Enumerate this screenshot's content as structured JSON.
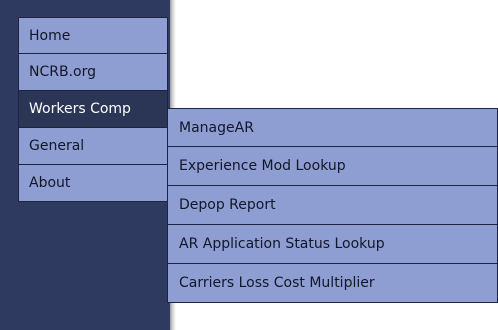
{
  "nav": {
    "items": [
      {
        "label": "Home"
      },
      {
        "label": "NCRB.org"
      },
      {
        "label": "Workers Comp"
      },
      {
        "label": "General"
      },
      {
        "label": "About"
      }
    ]
  },
  "submenu": {
    "parent": "Workers Comp",
    "items": [
      {
        "label": "ManageAR"
      },
      {
        "label": "Experience Mod Lookup"
      },
      {
        "label": "Depop Report"
      },
      {
        "label": "AR Application Status Lookup"
      },
      {
        "label": "Carriers Loss Cost Multiplier"
      }
    ]
  },
  "colors": {
    "sidebar_bg": "#2e3a60",
    "item_bg": "#8e9dd2",
    "active_item_bg": "#2b3556",
    "border": "#1c2440",
    "page_bg": "#ffffff"
  }
}
